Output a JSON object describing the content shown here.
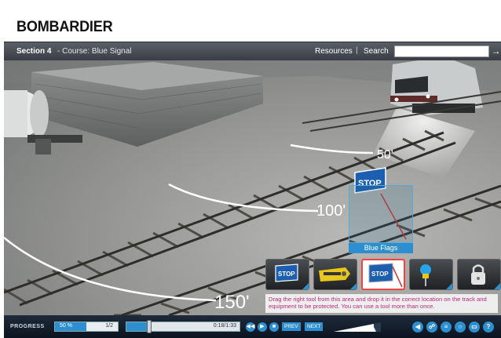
{
  "header": {
    "logo": "BOMBARDIER",
    "section": "Section 4",
    "course": "- Course: Blue Signal",
    "resources": "Resources",
    "separator": "|",
    "search": "Search",
    "search_value": "",
    "search_go": "→"
  },
  "scene": {
    "distance_labels": [
      "50'",
      "100'",
      "150'"
    ],
    "stop_sign_text": "STOP",
    "drop_zone_label": "Blue Flags"
  },
  "tools": [
    {
      "name": "stop-sign",
      "text": "STOP"
    },
    {
      "name": "derail",
      "text": ""
    },
    {
      "name": "stop-flag",
      "text": "STOP",
      "selected": true
    },
    {
      "name": "blue-light",
      "text": ""
    },
    {
      "name": "padlock",
      "text": ""
    }
  ],
  "instructions": "Drag the right tool from this area and drop it in the correct location on the track and equipment to be protected. You can use a tool more than once.",
  "bottom": {
    "progress_label": "PROGRESS",
    "progress_pct_text": "50 %",
    "progress_fraction": 0.5,
    "progress_pages": "1/2",
    "timeline_fraction": 0.2,
    "timeline_time": "0:18/1:33",
    "prev": "PREV",
    "next": "NEXT",
    "volume_fraction": 0.85
  },
  "colors": {
    "accent": "#2e8fd0",
    "instruction_text": "#c0287a",
    "nav_bar": "#4a4f55"
  }
}
